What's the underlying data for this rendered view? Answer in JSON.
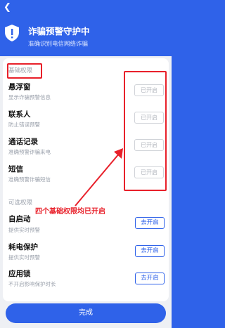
{
  "header": {
    "title": "诈骗预警守护中",
    "subtitle": "准确识别电信网络诈骗"
  },
  "basic": {
    "label": "基础权限",
    "items": [
      {
        "title": "悬浮窗",
        "sub": "显示诈骗预警信息",
        "status": "已开启"
      },
      {
        "title": "联系人",
        "sub": "防止错误预警",
        "status": "已开启"
      },
      {
        "title": "通话记录",
        "sub": "准确预警诈骗来电",
        "status": "已开启"
      },
      {
        "title": "短信",
        "sub": "准确预警诈骗短信",
        "status": "已开启"
      }
    ]
  },
  "optional": {
    "label": "可选权限",
    "items": [
      {
        "title": "自启动",
        "sub": "提供实时预警",
        "action": "去开启"
      },
      {
        "title": "耗电保护",
        "sub": "提供实时预警",
        "action": "去开启"
      },
      {
        "title": "应用锁",
        "sub": "不开启影响保护时长",
        "action": "去开启"
      }
    ]
  },
  "annotation": "四个基础权限均已开启",
  "done_label": "完成",
  "colors": {
    "primary": "#2f62e9",
    "annotation_red": "#e8202a"
  }
}
